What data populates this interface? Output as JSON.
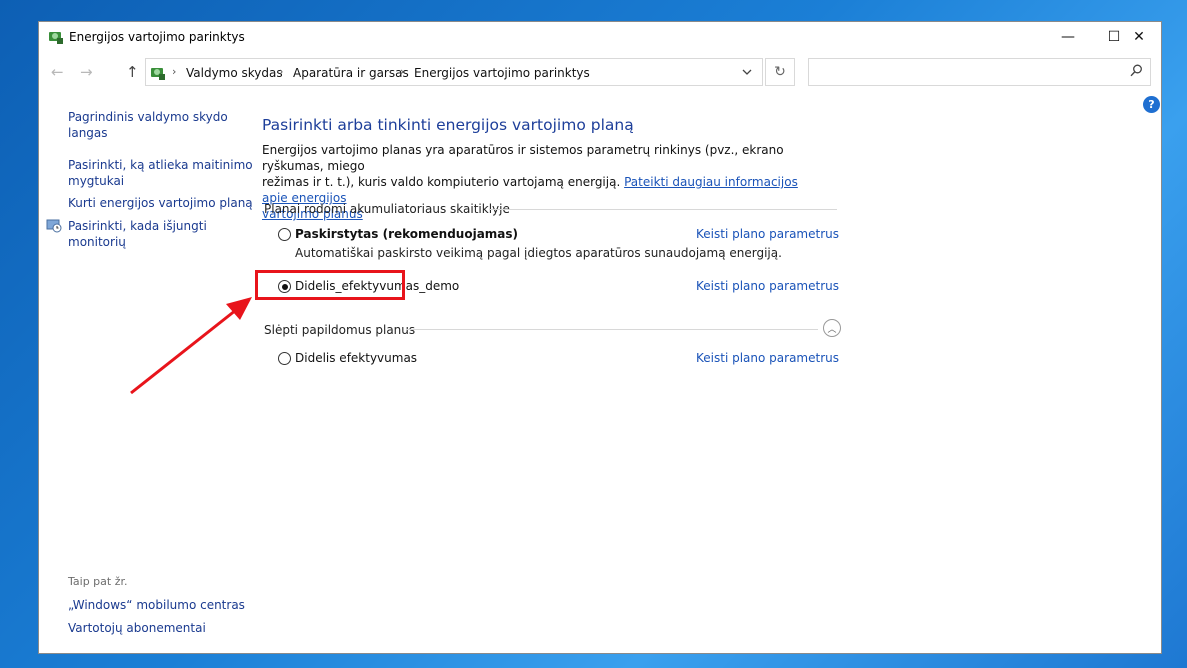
{
  "window": {
    "title": "Energijos vartojimo parinktys",
    "controls": {
      "minimize": "—",
      "maximize": "☐",
      "close": "✕"
    }
  },
  "nav": {
    "back": "←",
    "forward": "→",
    "up": "↑",
    "breadcrumbs": [
      "Valdymo skydas",
      "Aparatūra ir garsas",
      "Energijos vartojimo parinktys"
    ],
    "separator": "›",
    "refresh": "↻",
    "search_placeholder": ""
  },
  "help": "?",
  "sidebar": {
    "links": [
      {
        "label_line1": "Pagrindinis valdymo skydo",
        "label_line2": "langas"
      },
      {
        "label_line1": "Pasirinkti, ką atlieka maitinimo",
        "label_line2": "mygtukai"
      },
      {
        "label_line1": "Kurti energijos vartojimo planą",
        "label_line2": ""
      },
      {
        "label_line1": "Pasirinkti, kada išjungti",
        "label_line2": "monitorių"
      }
    ],
    "see_also": "Taip pat žr.",
    "footer_links": [
      "„Windows“ mobilumo centras",
      "Vartotojų abonementai"
    ]
  },
  "main": {
    "title": "Pasirinkti arba tinkinti energijos vartojimo planą",
    "description_line1": "Energijos vartojimo planas yra aparatūros ir sistemos parametrų rinkinys (pvz., ekrano ryškumas, miego",
    "description_line2": "režimas ir t. t.), kuris valdo kompiuterio vartojamą energiją.",
    "description_link_part1": "Pateikti daugiau informacijos apie energijos",
    "description_link_part2": "vartojimo planus",
    "section_battery": "Planai rodomi akumuliatoriaus skaitiklyje",
    "plans_battery": [
      {
        "name": "Paskirstytas (rekomenduojamas)",
        "description": "Automatiškai paskirsto veikimą pagal įdiegtos aparatūros sunaudojamą energiją.",
        "selected": false,
        "bold": true,
        "change_label": "Keisti plano parametrus"
      },
      {
        "name": "Didelis_efektyvumas_demo",
        "description": "",
        "selected": true,
        "bold": false,
        "change_label": "Keisti plano parametrus"
      }
    ],
    "section_hidden": "Slėpti papildomus planus",
    "collapse_icon": "︿",
    "plans_hidden": [
      {
        "name": "Didelis efektyvumas",
        "selected": false,
        "change_label": "Keisti plano parametrus"
      }
    ]
  },
  "annotation": {
    "highlight_color": "#e8141b",
    "arrow_color": "#e8141b"
  }
}
